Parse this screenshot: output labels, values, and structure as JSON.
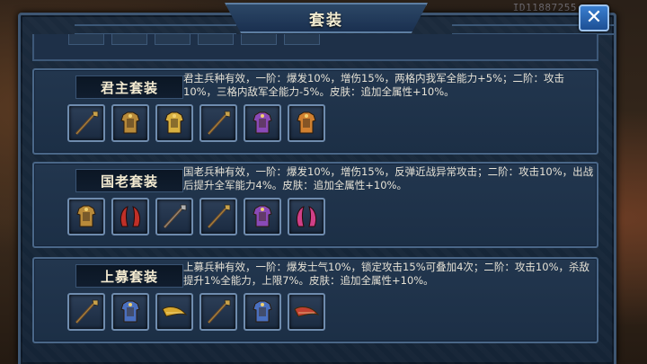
{
  "background": {
    "player_id": "ID11887255"
  },
  "dialog": {
    "title": "套装",
    "close_label": "✕"
  },
  "sets": [
    {
      "name": "君主套装",
      "description": "君主兵种有效，一阶：爆发10%，增伤15%，两格内我军全能力+5%；二阶：攻击10%，三格内敌军全能力-5%。皮肤：追加全属性+10%。",
      "items": [
        {
          "icon": "spear-icon",
          "color": "#c9a24a"
        },
        {
          "icon": "armor-icon",
          "color": "#b88a3a"
        },
        {
          "icon": "gold-armor-icon",
          "color": "#d8b040"
        },
        {
          "icon": "spear-icon",
          "color": "#c9a24a"
        },
        {
          "icon": "purple-armor-icon",
          "color": "#8a4ab8"
        },
        {
          "icon": "gold-armor-icon",
          "color": "#d08030"
        }
      ]
    },
    {
      "name": "国老套装",
      "description": "国老兵种有效，一阶：爆发10%，增伤15%，反弹近战异常攻击；二阶：攻击10%，出战后提升全军能力4%。皮肤：追加全属性+10%。",
      "items": [
        {
          "icon": "armor-icon",
          "color": "#b88a3a"
        },
        {
          "icon": "red-horns-icon",
          "color": "#c03028"
        },
        {
          "icon": "halberd-icon",
          "color": "#b0b0b0"
        },
        {
          "icon": "halberd-icon",
          "color": "#c9a24a"
        },
        {
          "icon": "purple-armor-icon",
          "color": "#8a4ab8"
        },
        {
          "icon": "pink-horns-icon",
          "color": "#d04088"
        }
      ]
    },
    {
      "name": "上募套装",
      "description": "上募兵种有效，一阶：爆发士气10%，锁定攻击15%可叠加4次；二阶：攻击10%，杀敌提升1%全能力，上限7%。皮肤：追加全属性+10%。",
      "items": [
        {
          "icon": "glaive-icon",
          "color": "#c9a24a"
        },
        {
          "icon": "blue-armor-icon",
          "color": "#4a70c0"
        },
        {
          "icon": "horn-icon",
          "color": "#d8a830"
        },
        {
          "icon": "glaive-icon",
          "color": "#c9a24a"
        },
        {
          "icon": "blue-armor-icon",
          "color": "#4a70c0"
        },
        {
          "icon": "dragon-horn-icon",
          "color": "#c04030"
        }
      ]
    }
  ]
}
